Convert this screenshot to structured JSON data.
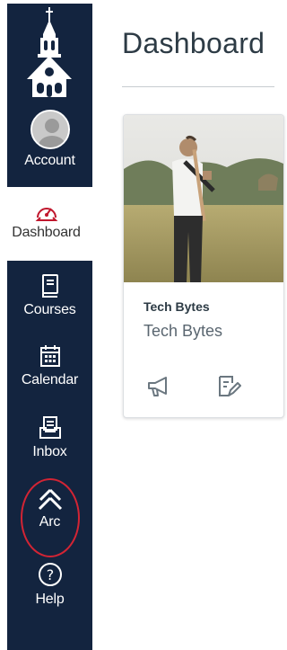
{
  "nav": {
    "items": [
      {
        "id": "account",
        "label": "Account",
        "icon": "user-avatar"
      },
      {
        "id": "dashboard",
        "label": "Dashboard",
        "icon": "speedometer-icon",
        "active": true
      },
      {
        "id": "courses",
        "label": "Courses",
        "icon": "book-icon"
      },
      {
        "id": "calendar",
        "label": "Calendar",
        "icon": "calendar-icon"
      },
      {
        "id": "inbox",
        "label": "Inbox",
        "icon": "inbox-icon"
      },
      {
        "id": "arc",
        "label": "Arc",
        "icon": "arc-icon"
      },
      {
        "id": "help",
        "label": "Help",
        "icon": "help-icon"
      }
    ],
    "colors": {
      "background": "#13243f",
      "active_accent": "#c0172d",
      "highlight_circle": "#d32434"
    }
  },
  "header": {
    "title": "Dashboard"
  },
  "card": {
    "course_code": "Tech Bytes",
    "course_name": "Tech Bytes",
    "actions": [
      "announcements-icon",
      "assignments-icon"
    ]
  }
}
